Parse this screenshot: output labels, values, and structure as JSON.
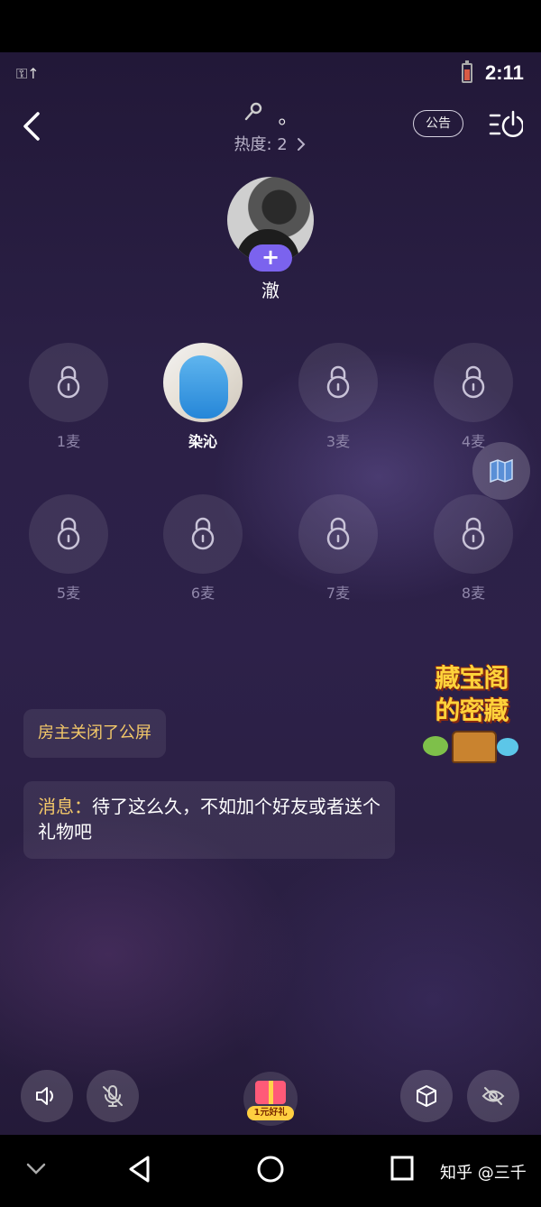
{
  "status_bar": {
    "left_icon": "wifi-key-icon",
    "left_text": "⚿↑",
    "time": "2:11",
    "battery_color": "#d95b45"
  },
  "header": {
    "title": "。",
    "heat_label": "热度: 2",
    "announce_label": "公告"
  },
  "host": {
    "name": "澈",
    "follow_label": "+"
  },
  "seats": [
    {
      "label": "1麦",
      "occupied": false
    },
    {
      "label": "染沁",
      "occupied": true
    },
    {
      "label": "3麦",
      "occupied": false
    },
    {
      "label": "4麦",
      "occupied": false
    },
    {
      "label": "5麦",
      "occupied": false
    },
    {
      "label": "6麦",
      "occupied": false
    },
    {
      "label": "7麦",
      "occupied": false
    },
    {
      "label": "8麦",
      "occupied": false
    }
  ],
  "banner": {
    "line1": "藏宝阁",
    "line2": "的密藏"
  },
  "chat": {
    "system_notice": "房主关闭了公屏",
    "message_prefix": "消息：",
    "message_text": "待了这么久，不如加个好友或者送个礼物吧"
  },
  "bottom_bar": {
    "gift_tag": "1元好礼"
  },
  "nav": {
    "watermark": "知乎 @三千"
  },
  "colors": {
    "accent": "#7b63ee",
    "notice_text": "#f3c869"
  }
}
